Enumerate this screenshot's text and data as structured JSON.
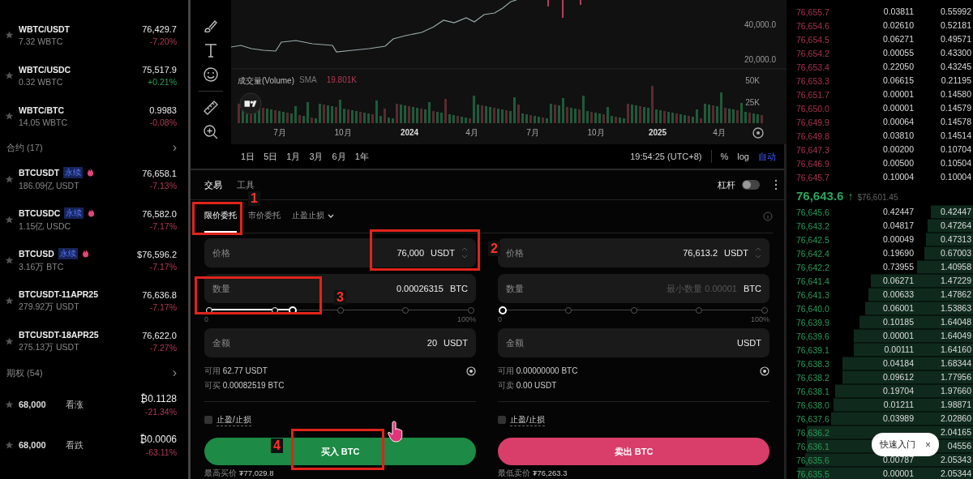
{
  "markets": {
    "spot": [
      {
        "name": "WBTC/USDT",
        "volume": "7.32 WBTC",
        "price": "76,429.7",
        "change": "-7.20%",
        "up": false
      },
      {
        "name": "WBTC/USDC",
        "volume": "0.32 WBTC",
        "price": "75,517.9",
        "change": "+0.21%",
        "up": true
      },
      {
        "name": "WBTC/BTC",
        "volume": "14.05 WBTC",
        "price": "0.9983",
        "change": "-0.08%",
        "up": false
      }
    ],
    "contracts": {
      "title": "合约 (17)",
      "arrow": "›",
      "items": [
        {
          "name": "BTCUSDT",
          "tag": "永续",
          "hot": true,
          "volume": "186.09亿 USDT",
          "price": "76,658.1",
          "change": "-7.13%",
          "up": false
        },
        {
          "name": "BTCUSDC",
          "tag": "永续",
          "hot": true,
          "volume": "1.15亿 USDC",
          "price": "76,582.0",
          "change": "-7.17%",
          "up": false
        },
        {
          "name": "BTCUSD",
          "tag": "永续",
          "hot": true,
          "volume": "3.16万 BTC",
          "price": "$76,596.2",
          "change": "-7.17%",
          "up": false
        },
        {
          "name": "BTCUSDT-11APR25",
          "hot": false,
          "volume": "279.92万 USDT",
          "price": "76,636.8",
          "change": "-7.17%",
          "up": false
        },
        {
          "name": "BTCUSDT-18APR25",
          "hot": false,
          "volume": "275.13万 USDT",
          "price": "76,622.0",
          "change": "-7.27%",
          "up": false
        }
      ]
    },
    "options": {
      "title": "期权 (54)",
      "arrow": "›",
      "items": [
        {
          "strike": "68,000",
          "type": "看涨",
          "price": "₿0.1128",
          "change": "-21.34%",
          "up": false
        },
        {
          "strike": "68,000",
          "type": "看跌",
          "price": "₿0.0006",
          "change": "-63.11%",
          "up": false
        }
      ]
    }
  },
  "chart": {
    "price_ticks": [
      "40,000.0",
      "20,000.0"
    ],
    "volume": {
      "label": "成交量(Volume)",
      "indicator": "SMA",
      "value": "19.801K"
    },
    "volume_ticks": [
      "50K",
      "25K"
    ],
    "time_labels": [
      {
        "label": "7月",
        "bold": false
      },
      {
        "label": "10月",
        "bold": false
      },
      {
        "label": "2024",
        "bold": true
      },
      {
        "label": "4月",
        "bold": false
      },
      {
        "label": "7月",
        "bold": false
      },
      {
        "label": "10月",
        "bold": false
      },
      {
        "label": "2025",
        "bold": true
      },
      {
        "label": "4月",
        "bold": false
      }
    ],
    "periods": [
      "1日",
      "5日",
      "1月",
      "3月",
      "6月",
      "1年"
    ],
    "clock": "19:54:25 (UTC+8)",
    "scales": [
      {
        "label": "%",
        "selected": false
      },
      {
        "label": "log",
        "selected": false
      },
      {
        "label": "自动",
        "selected": true
      }
    ]
  },
  "form": {
    "tabs": [
      {
        "label": "交易",
        "selected": true
      },
      {
        "label": "工具",
        "selected": false
      }
    ],
    "leverage": {
      "label": "杠杆",
      "on": false
    },
    "order_types": [
      {
        "label": "限价委托",
        "selected": true,
        "dropdown": false
      },
      {
        "label": "市价委托",
        "selected": false,
        "dropdown": false
      },
      {
        "label": "止盈止损",
        "selected": false,
        "dropdown": true
      }
    ],
    "sides": [
      {
        "kind": "buy",
        "price": {
          "label": "价格",
          "value": "76,000",
          "unit": "USDT"
        },
        "quantity": {
          "label": "数量",
          "value": "0.00026315",
          "unit": "BTC"
        },
        "slider": {
          "level": 0.32,
          "min": "0",
          "max": "100%"
        },
        "amount": {
          "label": "金额",
          "value": "20",
          "unit": "USDT"
        },
        "available": {
          "label": "可用",
          "value": "62.77 USDT"
        },
        "max": {
          "label": "可买",
          "value": "0.00082519 BTC"
        },
        "tpsl": {
          "label": "止盈/止损",
          "checked": false
        },
        "button": "买入 BTC",
        "best": {
          "label": "最高买价",
          "value": "₮77,029.8"
        }
      },
      {
        "kind": "sell",
        "price": {
          "label": "价格",
          "value": "76,613.2",
          "unit": "USDT"
        },
        "quantity": {
          "label": "数量",
          "placeholder": "最小数量 0.00001",
          "unit": "BTC"
        },
        "slider": {
          "level": 0,
          "min": "0",
          "max": "100%"
        },
        "amount": {
          "label": "金额",
          "unit": "USDT"
        },
        "available": {
          "label": "可用",
          "value": "0.00000000 BTC"
        },
        "max": {
          "label": "可卖",
          "value": "0.00 USDT"
        },
        "tpsl": {
          "label": "止盈/止损",
          "checked": false
        },
        "button": "卖出 BTC",
        "best": {
          "label": "最低卖价",
          "value": "₮76,263.3"
        }
      }
    ]
  },
  "order_book": {
    "asks": [
      {
        "price": "76,655.7",
        "qty": "0.03811",
        "total": "0.55992"
      },
      {
        "price": "76,654.6",
        "qty": "0.02610",
        "total": "0.52181"
      },
      {
        "price": "76,654.5",
        "qty": "0.06271",
        "total": "0.49571"
      },
      {
        "price": "76,654.2",
        "qty": "0.00055",
        "total": "0.43300"
      },
      {
        "price": "76,653.4",
        "qty": "0.22050",
        "total": "0.43245"
      },
      {
        "price": "76,653.3",
        "qty": "0.06615",
        "total": "0.21195"
      },
      {
        "price": "76,651.7",
        "qty": "0.00001",
        "total": "0.14580"
      },
      {
        "price": "76,650.0",
        "qty": "0.00001",
        "total": "0.14579"
      },
      {
        "price": "76,649.9",
        "qty": "0.00064",
        "total": "0.14578"
      },
      {
        "price": "76,649.8",
        "qty": "0.03810",
        "total": "0.14514"
      },
      {
        "price": "76,647.3",
        "qty": "0.00200",
        "total": "0.10704"
      },
      {
        "price": "76,646.9",
        "qty": "0.00500",
        "total": "0.10504"
      },
      {
        "price": "76,645.7",
        "qty": "0.10004",
        "total": "0.10004"
      }
    ],
    "last": {
      "price": "76,643.6",
      "arrow": "↑",
      "mark": "$76,601.45"
    },
    "bids": [
      {
        "price": "76,645.6",
        "qty": "0.42447",
        "total": "0.42447"
      },
      {
        "price": "76,643.2",
        "qty": "0.04817",
        "total": "0.47264"
      },
      {
        "price": "76,642.5",
        "qty": "0.00049",
        "total": "0.47313"
      },
      {
        "price": "76,642.4",
        "qty": "0.19690",
        "total": "0.67003"
      },
      {
        "price": "76,642.2",
        "qty": "0.73955",
        "total": "1.40958"
      },
      {
        "price": "76,641.4",
        "qty": "0.06271",
        "total": "1.47229"
      },
      {
        "price": "76,641.3",
        "qty": "0.00633",
        "total": "1.47862"
      },
      {
        "price": "76,640.0",
        "qty": "0.06001",
        "total": "1.53863"
      },
      {
        "price": "76,639.9",
        "qty": "0.10185",
        "total": "1.64048"
      },
      {
        "price": "76,639.6",
        "qty": "0.00001",
        "total": "1.64049"
      },
      {
        "price": "76,639.1",
        "qty": "0.00111",
        "total": "1.64160"
      },
      {
        "price": "76,638.3",
        "qty": "0.04184",
        "total": "1.68344"
      },
      {
        "price": "76,638.2",
        "qty": "0.09612",
        "total": "1.77956"
      },
      {
        "price": "76,638.1",
        "qty": "0.19704",
        "total": "1.97660"
      },
      {
        "price": "76,638.0",
        "qty": "0.01211",
        "total": "1.98871"
      },
      {
        "price": "76,637.6",
        "qty": "0.03989",
        "total": "2.02860"
      },
      {
        "price": "76,636.2",
        "total": "2.04165"
      },
      {
        "price": "76,636.1",
        "total": "04556"
      },
      {
        "price": "76,635.6",
        "qty": "0.00787",
        "total": "2.05343"
      },
      {
        "price": "76,635.5",
        "qty": "0.00001",
        "total": "2.05344"
      }
    ]
  },
  "tour": {
    "label": "快速入门",
    "close": "×"
  },
  "annotations": [
    {
      "label": "1"
    },
    {
      "label": "2"
    },
    {
      "label": "3"
    },
    {
      "label": "4"
    }
  ]
}
